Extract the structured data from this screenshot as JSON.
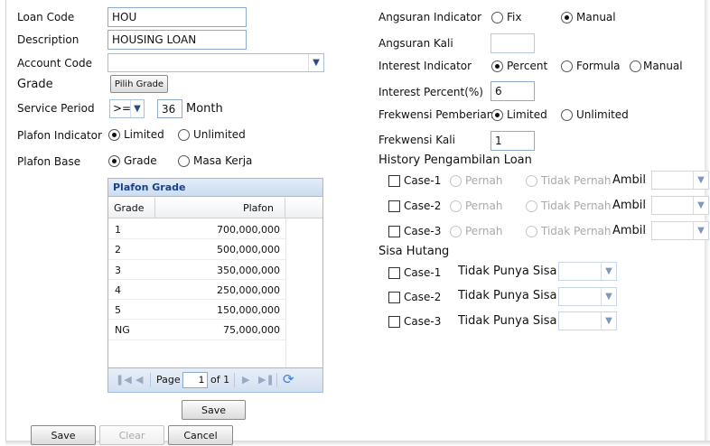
{
  "left": {
    "loan_code": {
      "label": "Loan Code",
      "value": "HOU"
    },
    "description": {
      "label": "Description",
      "value": "HOUSING LOAN"
    },
    "account_code": {
      "label": "Account Code",
      "value": ""
    },
    "grade": {
      "label": "Grade",
      "button": "Pilih Grade"
    },
    "service_period": {
      "label": "Service Period",
      "operator": ">=",
      "value": "36",
      "unit": "Month"
    },
    "plafon_indicator": {
      "label": "Plafon Indicator",
      "options": [
        "Limited",
        "Unlimited"
      ],
      "selected": "Limited"
    },
    "plafon_base": {
      "label": "Plafon Base",
      "options": [
        "Grade",
        "Masa Kerja"
      ],
      "selected": "Grade"
    }
  },
  "plafon_grid": {
    "title": "Plafon Grade",
    "columns": [
      "Grade",
      "Plafon"
    ],
    "rows": [
      {
        "grade": "1",
        "plafon": "700,000,000"
      },
      {
        "grade": "2",
        "plafon": "500,000,000"
      },
      {
        "grade": "3",
        "plafon": "350,000,000"
      },
      {
        "grade": "4",
        "plafon": "250,000,000"
      },
      {
        "grade": "5",
        "plafon": "150,000,000"
      },
      {
        "grade": "NG",
        "plafon": "75,000,000"
      }
    ],
    "pager": {
      "page_label": "Page",
      "page": "1",
      "of_label": "of 1"
    },
    "save_button": "Save"
  },
  "right": {
    "angsuran_indicator": {
      "label": "Angsuran Indicator",
      "options": [
        "Fix",
        "Manual"
      ],
      "selected": "Manual"
    },
    "angsuran_kali": {
      "label": "Angsuran Kali",
      "value": ""
    },
    "interest_indicator": {
      "label": "Interest Indicator",
      "options": [
        "Percent",
        "Formula",
        "Manual"
      ],
      "selected": "Percent"
    },
    "interest_percent": {
      "label": "Interest Percent(%)",
      "value": "6"
    },
    "frekwensi_pemberian": {
      "label": "Frekwensi Pemberian",
      "options": [
        "Limited",
        "Unlimited"
      ],
      "selected": "Limited"
    },
    "frekwensi_kali": {
      "label": "Frekwensi Kali",
      "value": "1"
    },
    "history": {
      "title": "History Pengambilan Loan",
      "cases": [
        {
          "label": "Case-1",
          "opt1": "Pernah",
          "opt2": "Tidak Pernah",
          "ambil": "Ambil"
        },
        {
          "label": "Case-2",
          "opt1": "Pernah",
          "opt2": "Tidak Pernah",
          "ambil": "Ambil"
        },
        {
          "label": "Case-3",
          "opt1": "Pernah",
          "opt2": "Tidak Pernah",
          "ambil": "Ambil"
        }
      ]
    },
    "sisa_hutang": {
      "title": "Sisa Hutang",
      "cases": [
        {
          "label": "Case-1",
          "text": "Tidak Punya Sisa"
        },
        {
          "label": "Case-2",
          "text": "Tidak Punya Sisa"
        },
        {
          "label": "Case-3",
          "text": "Tidak Punya Sisa"
        }
      ]
    }
  },
  "footer": {
    "save": "Save",
    "clear": "Clear",
    "cancel": "Cancel"
  }
}
